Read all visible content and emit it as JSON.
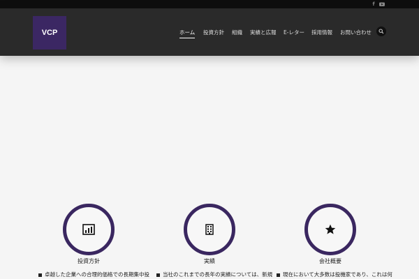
{
  "social": {
    "facebook": "f",
    "youtube": "You Tube"
  },
  "logo": {
    "text": "VCP",
    "color": "#3b2763"
  },
  "nav": {
    "items": [
      {
        "label": "ホーム",
        "active": true
      },
      {
        "label": "投資方針"
      },
      {
        "label": "組織"
      },
      {
        "label": "実績と広報"
      },
      {
        "label": "E-レター"
      },
      {
        "label": "採用情報"
      },
      {
        "label": "お問い合わせ"
      }
    ],
    "search_icon": "search-icon"
  },
  "features": [
    {
      "icon": "bar-chart-icon",
      "title": "投資方針",
      "text": "卓越した企業への合理的価格での長期集中投"
    },
    {
      "icon": "building-icon",
      "title": "実績",
      "text": "当社のこれまでの長年の実績については、新規"
    },
    {
      "icon": "star-icon",
      "title": "会社概要",
      "text": "現在において大多数は投機家であり、これは何"
    }
  ],
  "colors": {
    "brand": "#3b2763",
    "header": "#2a2a2a",
    "topbar": "#0e0e0e"
  }
}
